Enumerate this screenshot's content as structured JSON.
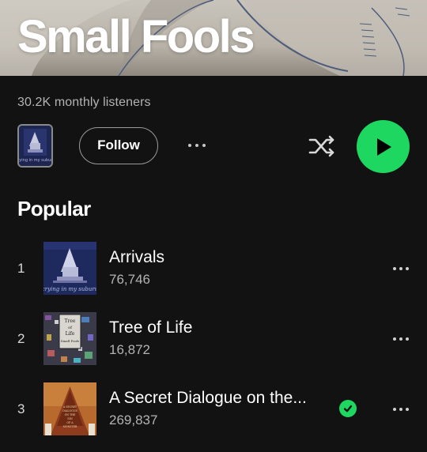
{
  "artist": {
    "name": "Small Fools",
    "monthly_listeners": "30.2K monthly listeners"
  },
  "actions": {
    "follow_label": "Follow",
    "more_icon": "more-horizontal-icon",
    "shuffle_icon": "shuffle-icon",
    "play_icon": "play-icon"
  },
  "popular": {
    "title": "Popular",
    "tracks": [
      {
        "number": "1",
        "title": "Arrivals",
        "plays": "76,746",
        "saved": false,
        "art_caption": "crying in my suburu"
      },
      {
        "number": "2",
        "title": "Tree of Life",
        "plays": "16,872",
        "saved": false
      },
      {
        "number": "3",
        "title": "A Secret Dialogue on the...",
        "plays": "269,837",
        "saved": true
      }
    ]
  },
  "colors": {
    "background": "#121212",
    "accent_green": "#1ed760",
    "secondary_text": "#b3b3b3"
  }
}
